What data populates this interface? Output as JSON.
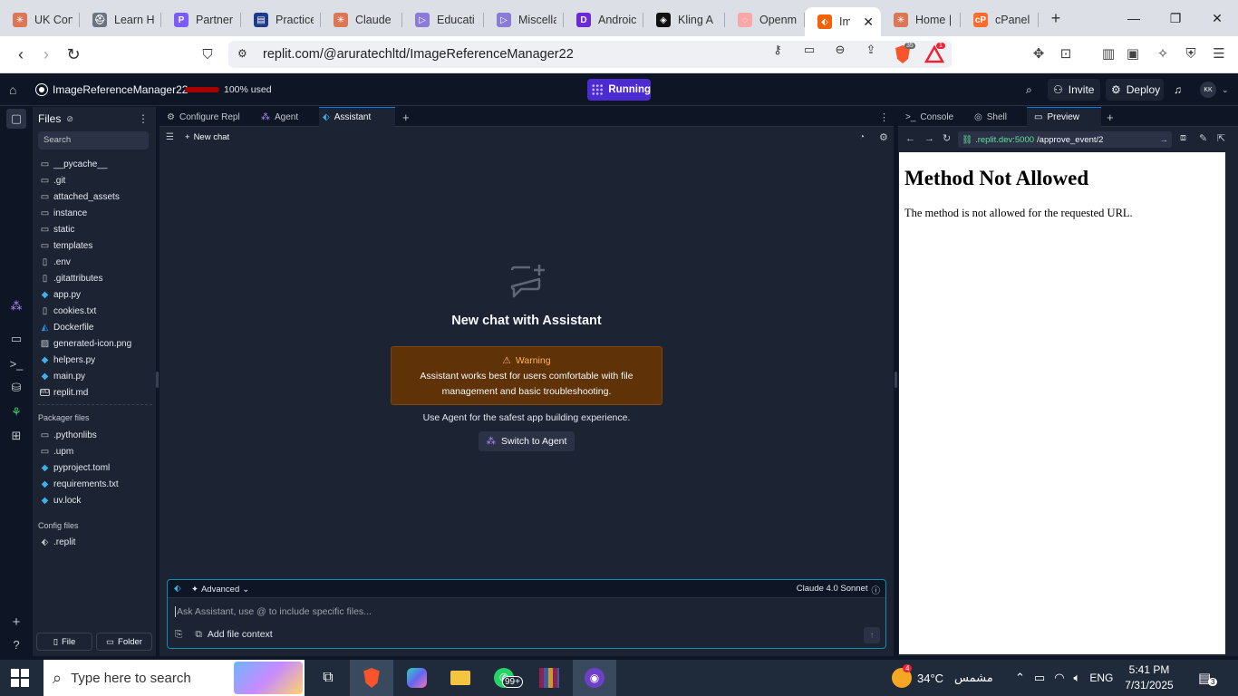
{
  "browser": {
    "tabs": [
      {
        "label": "UK Con",
        "color": "#d97757",
        "glyph": "✳"
      },
      {
        "label": "Learn H",
        "color": "#6b7280",
        "glyph": "⛑"
      },
      {
        "label": "Partner",
        "color": "#7c5cff",
        "glyph": "P"
      },
      {
        "label": "Practice",
        "color": "#1e3a8a",
        "glyph": "▤"
      },
      {
        "label": "Claude",
        "color": "#d97757",
        "glyph": "✳"
      },
      {
        "label": "Educati",
        "color": "#8b7bd8",
        "glyph": "▷"
      },
      {
        "label": "Miscella",
        "color": "#8b7bd8",
        "glyph": "▷"
      },
      {
        "label": "Androic",
        "color": "#6d28d9",
        "glyph": "D"
      },
      {
        "label": "Kling A",
        "color": "#111111",
        "glyph": "◈"
      },
      {
        "label": "Openm",
        "color": "#f9a8a8",
        "glyph": "◌"
      },
      {
        "label": "Ima",
        "color": "#f26207",
        "glyph": "⬖",
        "active": true
      },
      {
        "label": "Home |",
        "color": "#d97757",
        "glyph": "✳"
      },
      {
        "label": "cPanel",
        "color": "#ff6c2c",
        "glyph": "cP"
      }
    ],
    "url": "replit.com/@aruratechltd/ImageReferenceManager22",
    "brave_badge": "35",
    "alert_badge": "1"
  },
  "replit_top": {
    "repl_name": "ImageReferenceManager22",
    "usage_text": "100% used",
    "run_label": "Running",
    "invite_label": "Invite",
    "deploy_label": "Deploy",
    "avatar_initials": "KK"
  },
  "files_panel": {
    "title": "Files",
    "search_placeholder": "Search",
    "items": [
      {
        "name": "__pycache__",
        "type": "folder"
      },
      {
        "name": ".git",
        "type": "folder"
      },
      {
        "name": "attached_assets",
        "type": "folder"
      },
      {
        "name": "instance",
        "type": "folder"
      },
      {
        "name": "static",
        "type": "folder"
      },
      {
        "name": "templates",
        "type": "folder"
      },
      {
        "name": ".env",
        "type": "file"
      },
      {
        "name": ".gitattributes",
        "type": "file"
      },
      {
        "name": "app.py",
        "type": "python"
      },
      {
        "name": "cookies.txt",
        "type": "file"
      },
      {
        "name": "Dockerfile",
        "type": "docker"
      },
      {
        "name": "generated-icon.png",
        "type": "image"
      },
      {
        "name": "helpers.py",
        "type": "python"
      },
      {
        "name": "main.py",
        "type": "python"
      },
      {
        "name": "replit.md",
        "type": "markdown"
      }
    ],
    "packager_title": "Packager files",
    "packager_items": [
      {
        "name": ".pythonlibs",
        "type": "folder"
      },
      {
        "name": ".upm",
        "type": "folder"
      },
      {
        "name": "pyproject.toml",
        "type": "python"
      },
      {
        "name": "requirements.txt",
        "type": "python"
      },
      {
        "name": "uv.lock",
        "type": "python"
      }
    ],
    "config_title": "Config files",
    "config_items": [
      {
        "name": ".replit",
        "type": "replit"
      }
    ],
    "file_button": "File",
    "folder_button": "Folder"
  },
  "center": {
    "tabs": [
      {
        "label": "Configure Repl"
      },
      {
        "label": "Agent"
      },
      {
        "label": "Assistant",
        "active": true
      }
    ],
    "new_chat_label": "New chat",
    "heading": "New chat with Assistant",
    "warning_title": "Warning",
    "warning_body": "Assistant works best for users comfortable with file management and basic troubleshooting.",
    "agent_hint": "Use Agent for the safest app building experience.",
    "switch_label": "Switch to Agent",
    "composer": {
      "mode_label": "Advanced",
      "model_label": "Claude 4.0 Sonnet",
      "placeholder": "Ask Assistant, use @ to include specific files...",
      "add_context_label": "Add file context"
    }
  },
  "right": {
    "tabs": [
      {
        "label": "Console"
      },
      {
        "label": "Shell"
      },
      {
        "label": "Preview",
        "active": true
      }
    ],
    "preview_host": ".replit.dev:5000",
    "preview_path": "/approve_event/2",
    "page_heading": "Method Not Allowed",
    "page_text": "The method is not allowed for the requested URL."
  },
  "taskbar": {
    "search_placeholder": "Type here to search",
    "whatsapp_badge": "99+",
    "weather_badge": "4",
    "temperature": "34°C",
    "weather_text": "مشمس",
    "language": "ENG",
    "time": "5:41 PM",
    "date": "7/31/2025",
    "notifications": "3"
  },
  "colors": {
    "accent_blue": "#0079f2",
    "run_purple": "#4c2bd1",
    "warning_bg": "#5f3207",
    "warning_text": "#ffb45c",
    "panel_bg": "#1c2333",
    "app_bg": "#0e1525"
  }
}
